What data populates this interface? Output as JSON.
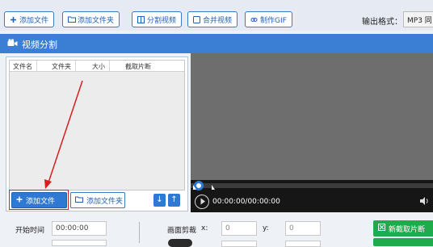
{
  "toolbar": {
    "add_file": "添加文件",
    "add_folder": "添加文件夹",
    "split_video": "分割视频",
    "merge_video": "合并视频",
    "make_gif": "制作GIF",
    "output_format_label": "输出格式：",
    "output_format_value": "MP3 同"
  },
  "section": {
    "title": "视频分割"
  },
  "file_table": {
    "columns": [
      "文件名",
      "文件夹",
      "大小",
      "截取片断"
    ]
  },
  "file_panel": {
    "add_file": "添加文件",
    "add_folder": "添加文件夹",
    "down_arrow": "↓",
    "up_arrow": "↑"
  },
  "player": {
    "time": "00:00:00/00:00:00"
  },
  "controls": {
    "start_time_label": "开始时间",
    "start_time_value": "00:00:00",
    "crop_label": "画面剪裁",
    "x_label": "x:",
    "x_value": "0",
    "y_label": "y:",
    "y_value": "0",
    "new_clip_button": "新截取片断"
  },
  "colors": {
    "accent": "#2f79d4",
    "header_bar": "#3a7fd4",
    "highlight_red": "#d81e1e",
    "green_button": "#1faa4b"
  }
}
